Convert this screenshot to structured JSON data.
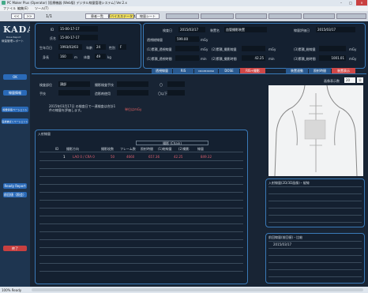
{
  "window": {
    "title": "PC Maker Plus (Operator)   [医療機器 (Web版) デジタル線量管理システム]   Ver.2.x",
    "menu": [
      "ファイル",
      "編集(E)",
      "ツール(T)"
    ],
    "close": "×"
  },
  "toolbar": {
    "back": "<<",
    "fwd": ">>",
    "page": "1/1",
    "tabs": [
      "患者一覧",
      "デバイスステータス",
      "線量シート"
    ]
  },
  "sidebar": {
    "logo": "KADA",
    "logo_sub": "Dose Report",
    "subtitle": "線量管理レポート",
    "buttons": [
      "OK",
      "線量情報",
      "線量情報/ペーシェント",
      "医療被ばくペーシェント",
      "Ready Report",
      "前回値（照会）",
      "終了"
    ]
  },
  "patient": {
    "id_label": "ID",
    "id": "15-00-17-17",
    "name_label": "氏名",
    "name": "15-00-17-17",
    "dob_label": "生年月日",
    "dob": "1993/03/03",
    "age_label": "年齢",
    "age": "24",
    "sex_label": "性別",
    "sex": "F",
    "height_label": "身長",
    "height": "160",
    "height_unit": "m",
    "weight_label": "体重",
    "weight": "49",
    "weight_unit": "kg"
  },
  "study": {
    "date_label": "検査日",
    "date": "2015/03/17",
    "room_label": "装置名",
    "room": "血管撮影装置",
    "dept_label": "線量評価日",
    "dept": "2015/03/17"
  },
  "dose": {
    "r1": [
      "透視総線量",
      "599.00",
      "mGy"
    ],
    "r2": [
      "(1)累積_透視線量",
      "",
      "mGy",
      "(2)累積_撮影線量",
      "",
      "mGy",
      "(3)累積_総線量",
      "",
      "mGy"
    ],
    "r3": [
      "(1)累積_透視時間",
      "",
      "min",
      "(2)累積_撮影時間",
      "42.25",
      "min",
      "(3)累積_総時間",
      "1001.01",
      "mGy"
    ]
  },
  "tabs": [
    "透視線量",
    "RIS",
    "DICOM RDSR",
    "DOSE",
    "RIS+撮影",
    "",
    "",
    "装置連動",
    "照射時間",
    "装置表示"
  ],
  "study_info": {
    "r1": [
      "検査部位",
      "頭部",
      "撮影検査手技",
      "",
      "〇",
      ""
    ],
    "r2": [
      "手技",
      "",
      "造影剤使用",
      "",
      "〇以下",
      ""
    ],
    "note": "2015年03月17日 の検査日で一連検査は合計1件の線量を評価します。",
    "note2": "単位はmGy"
  },
  "table": {
    "title": "入射線量",
    "group": "撮影 (Chain)",
    "headers": [
      "ID",
      "撮影方向",
      "撮影枚数",
      "フレーム数",
      "照射時間",
      "(1)総線量",
      "(2)撮影",
      "線量"
    ],
    "rows": [
      [
        "1",
        "LAO 0 / CRA 0",
        "50",
        "4660",
        "657.36",
        "42.25",
        "849.32"
      ]
    ]
  },
  "right": {
    "count_label": "画像表示数",
    "count": "20",
    "scale": "Ⓐ",
    "list1_title": "入射線量(2D/3D画像)・縦線",
    "list2_title": "前回線量(前回値)・比較",
    "list2_row": "2015/03/17"
  },
  "status": {
    "text": "100%   Ready"
  }
}
